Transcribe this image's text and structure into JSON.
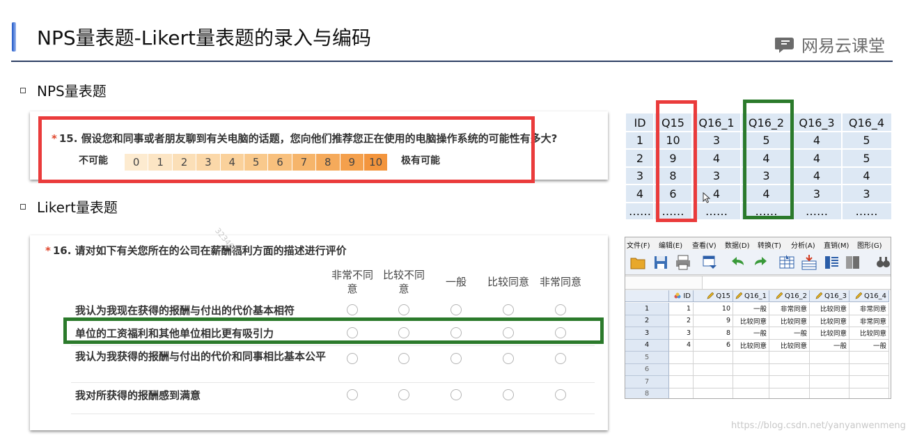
{
  "header": {
    "title": "NPS量表题-Likert量表题的录入与编码",
    "brand": "网易云课堂",
    "brand_icon": "chat-bubble-icon",
    "accent_color": "#1f57c8"
  },
  "sections": {
    "nps_label": "NPS量表题",
    "likert_label": "Likert量表题"
  },
  "nps": {
    "required_mark": "*",
    "question": "15. 假设您和同事或者朋友聊到有关电脑的话题，您向他们推荐您正在使用的电脑操作系统的可能性有多大?",
    "low_label": "不可能",
    "high_label": "极有可能",
    "scale": [
      {
        "label": "0",
        "color": "#fdebd0"
      },
      {
        "label": "1",
        "color": "#fce5c4"
      },
      {
        "label": "2",
        "color": "#fbdfb7"
      },
      {
        "label": "3",
        "color": "#fbd8a9"
      },
      {
        "label": "4",
        "color": "#fad19b"
      },
      {
        "label": "5",
        "color": "#f9c98c"
      },
      {
        "label": "6",
        "color": "#f8c07d"
      },
      {
        "label": "7",
        "color": "#f6b56b"
      },
      {
        "label": "8",
        "color": "#f5aa5b"
      },
      {
        "label": "9",
        "color": "#f4a04c"
      },
      {
        "label": "10",
        "color": "#f3953d"
      }
    ]
  },
  "likert": {
    "required_mark": "*",
    "question": "16. 请对如下有关您所在的公司在薪酬福利方面的描述进行评价",
    "columns": [
      "非常不同意",
      "比较不同意",
      "一般",
      "比较同意",
      "非常同意"
    ],
    "rows": [
      "我认为我现在获得的报酬与付出的代价基本相符",
      "单位的工资福利和其他单位相比更有吸引力",
      "我认为我获得的报酬与付出的代价和同事相比基本公平",
      "我对所获得的报酬感到满意"
    ]
  },
  "data_table": {
    "headers": [
      "ID",
      "Q15",
      "Q16_1",
      "Q16_2",
      "Q16_3",
      "Q16_4"
    ],
    "rows": [
      [
        "1",
        "10",
        "3",
        "5",
        "4",
        "5"
      ],
      [
        "2",
        "9",
        "4",
        "4",
        "4",
        "5"
      ],
      [
        "3",
        "8",
        "3",
        "3",
        "4",
        "4"
      ],
      [
        "4",
        "6",
        "4",
        "4",
        "3",
        "3"
      ],
      [
        "……",
        "……",
        "……",
        "……",
        "……",
        "……"
      ]
    ]
  },
  "spss": {
    "menu": [
      "文件(F)",
      "编辑(E)",
      "查看(V)",
      "数据(D)",
      "转换(T)",
      "分析(A)",
      "直销(M)",
      "图形(G)"
    ],
    "toolbar_icons": [
      "open-folder-icon",
      "save-icon",
      "print-icon",
      "dialog-recall-icon",
      "undo-icon",
      "redo-icon",
      "goto-case-icon",
      "goto-variable-icon",
      "variables-icon",
      "split-file-icon",
      "find-icon"
    ],
    "columns": [
      "ID",
      "Q15",
      "Q16_1",
      "Q16_2",
      "Q16_3",
      "Q16_4"
    ],
    "row_numbers": [
      "1",
      "2",
      "3",
      "4",
      "5",
      "6",
      "7",
      "8"
    ],
    "rows": [
      [
        "1",
        "10",
        "一般",
        "非常同意",
        "比较同意",
        "非常同意"
      ],
      [
        "2",
        "9",
        "比较同意",
        "比较同意",
        "比较同意",
        "非常同意"
      ],
      [
        "3",
        "8",
        "一般",
        "一般",
        "比较同意",
        "比较同意"
      ],
      [
        "4",
        "6",
        "比较同意",
        "比较同意",
        "一般",
        "一般"
      ]
    ]
  },
  "watermarks": {
    "url": "https://blog.csdn.net/yanyanwenmeng",
    "number": "3234666"
  },
  "highlight_colors": {
    "red": "#ea3b3b",
    "green": "#2b7a2b"
  }
}
